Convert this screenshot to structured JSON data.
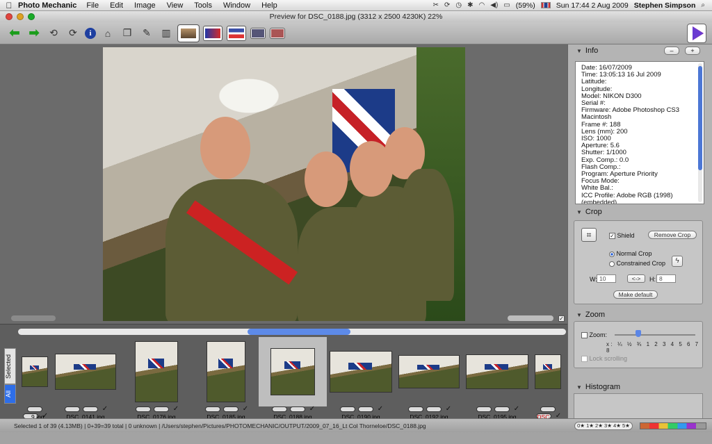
{
  "menubar": {
    "app_name": "Photo Mechanic",
    "menus": [
      "File",
      "Edit",
      "Image",
      "View",
      "Tools",
      "Window",
      "Help"
    ],
    "battery": "(59%)",
    "clock": "Sun 17:44 2 Aug 2009",
    "user": "Stephen Simpson"
  },
  "window": {
    "title": "Preview for DSC_0188.jpg (3312 x 2500 4230K) 22%",
    "colors": {
      "close": "#e0443e",
      "minimize": "#dea123",
      "zoom": "#1aab29"
    }
  },
  "inspector": {
    "info": {
      "title": "Info",
      "minus": "–",
      "plus": "+",
      "lines": [
        "Date: 16/07/2009",
        "Time: 13:05:13 16 Jul 2009",
        "Latitude:",
        "Longitude:",
        "Model: NIKON D300",
        "Serial #:",
        "Firmware: Adobe Photoshop CS3",
        "Macintosh",
        "Frame #: 188",
        "Lens (mm): 200",
        "ISO: 1000",
        "Aperture: 5.6",
        "Shutter: 1/1000",
        "Exp. Comp.: 0.0",
        "Flash Comp.:",
        "Program: Aperture Priority",
        "Focus Mode:",
        "White Bal.:",
        "ICC Profile: Adobe RGB (1998)",
        "(embedded)"
      ]
    },
    "crop": {
      "title": "Crop",
      "shield_label": "Shield",
      "remove_label": "Remove Crop",
      "normal_label": "Normal Crop",
      "constrained_label": "Constrained Crop",
      "w_label": "W:",
      "w_value": "10",
      "swap_label": "<->",
      "h_label": "H:",
      "h_value": "8",
      "default_label": "Make default"
    },
    "zoom": {
      "title": "Zoom",
      "zoom_label": "Zoom:",
      "ticks": "x: ¼ ½ ¾ 1 2 3 4 5 6 7 8",
      "lock_label": "Lock scrolling"
    },
    "histogram": {
      "title": "Histogram"
    }
  },
  "strip": {
    "tabs": {
      "selected": "Selected",
      "all": "All"
    },
    "thumbnails": [
      {
        "name": "…9.jpg",
        "selected": false,
        "red": false
      },
      {
        "name": "DSC_0141.jpg",
        "selected": false,
        "red": false
      },
      {
        "name": "DSC_0176.jpg",
        "selected": false,
        "red": false
      },
      {
        "name": "DSC_0185.jpg",
        "selected": false,
        "red": false
      },
      {
        "name": "DSC_0188.jpg",
        "selected": true,
        "red": false
      },
      {
        "name": "DSC_0190.jpg",
        "selected": false,
        "red": false
      },
      {
        "name": "DSC_0192.jpg",
        "selected": false,
        "red": false
      },
      {
        "name": "DSC_0195.jpg",
        "selected": false,
        "red": false
      },
      {
        "name": "DSC_…",
        "selected": false,
        "red": true
      }
    ]
  },
  "status": {
    "text": "Selected 1 of 39 (4.13MB) | 0+39=39 total | 0 unknown | /Users/stephen/Pictures/PHOTOMECHANIC/OUTPUT/2009_07_16_Lt Col Thorneloe/DSC_0188.jpg",
    "stars": "0★ 1★ 2★ 3★ 4★ 5★"
  }
}
